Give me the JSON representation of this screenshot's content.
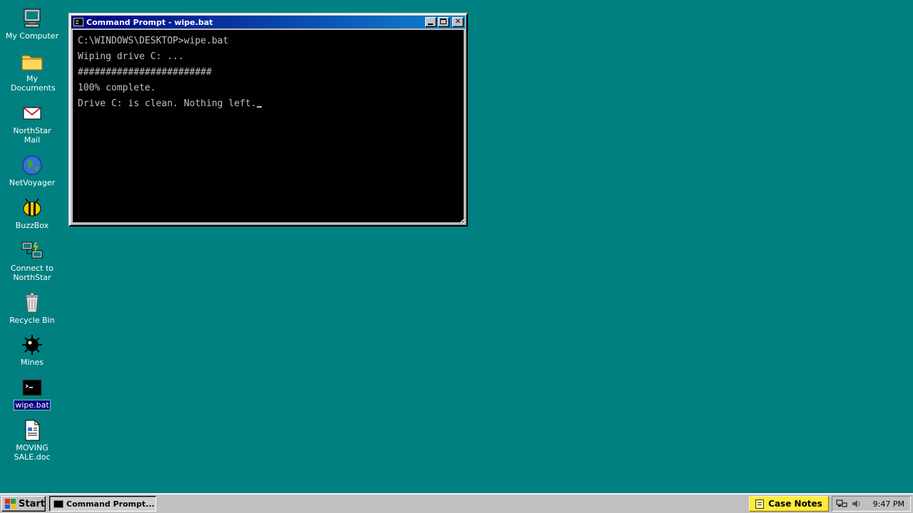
{
  "desktop": {
    "icons": [
      {
        "label": "My Computer",
        "icon": "my-computer-icon"
      },
      {
        "label": "My Documents",
        "icon": "folder-icon"
      },
      {
        "label": "NorthStar Mail",
        "icon": "mail-envelope-icon"
      },
      {
        "label": "NetVoyager",
        "icon": "globe-icon"
      },
      {
        "label": "BuzzBox",
        "icon": "bee-icon"
      },
      {
        "label": "Connect to NorthStar",
        "icon": "network-computers-icon"
      },
      {
        "label": "Recycle Bin",
        "icon": "recycle-bin-icon"
      },
      {
        "label": "Mines",
        "icon": "mine-icon"
      },
      {
        "label": "wipe.bat",
        "icon": "batch-file-icon",
        "selected": true
      },
      {
        "label": "MOVING SALE.doc",
        "icon": "document-icon"
      }
    ]
  },
  "window": {
    "title": "Command Prompt - wipe.bat",
    "controls": {
      "minimize": "minimize",
      "maximize": "maximize",
      "close": "close"
    },
    "console_lines": [
      "C:\\WINDOWS\\DESKTOP>wipe.bat",
      "Wiping drive C: ...",
      "########################",
      "100% complete.",
      "Drive C: is clean. Nothing left."
    ]
  },
  "taskbar": {
    "start_label": "Start",
    "task_label": "Command Prompt...",
    "notes_label": "Case Notes",
    "clock": "9:47 PM"
  },
  "colors": {
    "desktop": "#008080",
    "titlebar": "#000080",
    "console_bg": "#000000",
    "console_fg": "#c0c0c0",
    "notes_button": "#ffeb3b"
  }
}
